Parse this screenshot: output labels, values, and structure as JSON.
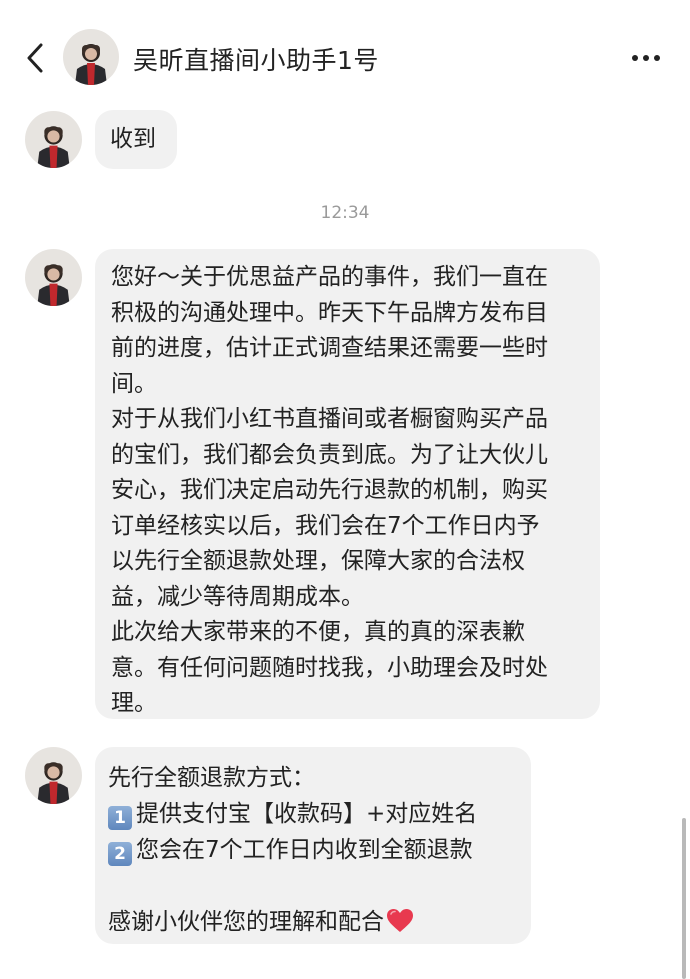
{
  "header": {
    "title": "吴昕直播间小助手1号",
    "back_icon": "chevron-left-icon",
    "more_icon": "more-horizontal-icon"
  },
  "messages": [
    {
      "text": "收到"
    },
    {
      "lines": [
        "您好～关于优思益产品的事件，我们一直在",
        "积极的沟通处理中。昨天下午品牌方发布目",
        "前的进度，估计正式调查结果还需要一些时",
        "间。",
        "对于从我们小红书直播间或者橱窗购买产品",
        "的宝们，我们都会负责到底。为了让大伙儿",
        "安心，我们决定启动先行退款的机制，购买",
        "订单经核实以后，我们会在7个工作日内予",
        "以先行全额退款处理，保障大家的合法权",
        "益，减少等待周期成本。",
        "此次给大家带来的不便，真的真的深表歉",
        "意。有任何问题随时找我，小助理会及时处",
        "理。"
      ]
    },
    {
      "line1": "先行全额退款方式：",
      "step1_num": "1",
      "step1_text": "提供支付宝【收款码】+对应姓名",
      "step2_num": "2",
      "step2_text": "您会在7个工作日内收到全额退款",
      "closing": "感谢小伙伴您的理解和配合"
    }
  ],
  "timestamp": "12:34",
  "colors": {
    "bubble_bg": "#f1f1f1",
    "text": "#222222",
    "timestamp": "#9a9a9a",
    "heart": "#e8394f",
    "keycap": "#6f93c6"
  },
  "icons": {
    "heart": "red-heart-icon",
    "keycap_1": "keycap-1-icon",
    "keycap_2": "keycap-2-icon",
    "avatar": "avatar-woman-red-scarf"
  }
}
